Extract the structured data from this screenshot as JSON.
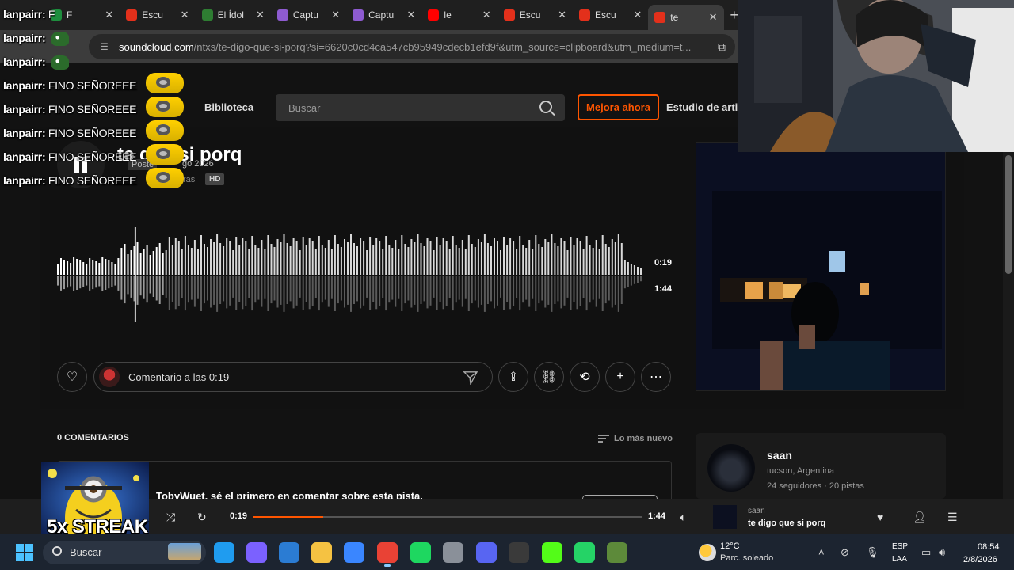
{
  "browser": {
    "tabs": [
      {
        "title": "F",
        "color": "#1e8e3e"
      },
      {
        "title": "Escu",
        "color": "#e3301b"
      },
      {
        "title": "El Ídol",
        "color": "#2e7d32"
      },
      {
        "title": "Captu",
        "color": "#8e5bd1"
      },
      {
        "title": "Captu",
        "color": "#8e5bd1"
      },
      {
        "title": "le",
        "color": "#ff0000"
      },
      {
        "title": "Escu",
        "color": "#e3301b"
      },
      {
        "title": "Escu",
        "color": "#e3301b"
      },
      {
        "title": "te",
        "color": "#e3301b",
        "active": true
      }
    ],
    "url_host": "soundcloud.com",
    "url_path": "/ntxs/te-digo-que-si-porq?si=6620c0cd4ca547cb95949cdecb1efd9f&utm_source=clipboard&utm_medium=t..."
  },
  "header": {
    "library": "Biblioteca",
    "search_placeholder": "Buscar",
    "upgrade": "Mejora ahora",
    "artist_studio": "Estudio de artis"
  },
  "track": {
    "title": "te digo que si porq",
    "title_visible": "te      que si porq",
    "posted": "Poste",
    "posted_date": "go 2026",
    "artist_tail": "ras",
    "hd": "HD",
    "current_time": "0:19",
    "total_time": "1:44",
    "progress_fraction": 0.18
  },
  "actions": {
    "comment_placeholder": "Comentario a las 0:19"
  },
  "comments": {
    "count_label": "0 COMENTARIOS",
    "sort_label": "Lo más nuevo",
    "empty_text": "TobyWuet, sé el primero en comentar sobre esta pista."
  },
  "artist": {
    "name": "saan",
    "location": "tucson, Argentina",
    "stats": "24 seguidores · 20 pistas"
  },
  "player": {
    "current": "0:19",
    "total": "1:44",
    "artist": "saan",
    "track": "te digo que si porq"
  },
  "chat": {
    "lines": [
      {
        "user": "lanpairr:",
        "msg": "F",
        "emote": "none"
      },
      {
        "user": "lanpairr:",
        "msg": "",
        "emote": "frog"
      },
      {
        "user": "lanpairr:",
        "msg": "",
        "emote": "frog"
      },
      {
        "user": "lanpairr:",
        "msg": "FINO SEÑOREEE",
        "emote": "minion"
      },
      {
        "user": "lanpairr:",
        "msg": "FINO SEÑOREEE",
        "emote": "minion"
      },
      {
        "user": "lanpairr:",
        "msg": "FINO SEÑOREEE",
        "emote": "minion"
      },
      {
        "user": "lanpairr:",
        "msg": "FINO SEÑOREEE",
        "emote": "minion"
      },
      {
        "user": "lanpairr:",
        "msg": "FINO SEÑOREEE",
        "emote": "minion"
      }
    ]
  },
  "overlay": {
    "streak": "5x STREAK"
  },
  "taskbar": {
    "search": "Buscar",
    "weather_temp": "12°C",
    "weather_desc": "Parc. soleado",
    "lang1": "ESP",
    "lang2": "LAA",
    "time": "08:54",
    "date": "2/8/2026",
    "apps": [
      {
        "name": "edge-icon",
        "color": "#1f9cf0"
      },
      {
        "name": "copilot-icon",
        "color": "#7b61ff"
      },
      {
        "name": "outlook-icon",
        "color": "#2b7cd3"
      },
      {
        "name": "file-explorer-icon",
        "color": "#f5c242"
      },
      {
        "name": "store-icon",
        "color": "#3a86ff"
      },
      {
        "name": "chrome-icon",
        "color": "#e94235"
      },
      {
        "name": "spotify-icon",
        "color": "#1ed760"
      },
      {
        "name": "settings-icon",
        "color": "#8a9099"
      },
      {
        "name": "discord-icon",
        "color": "#5865f2"
      },
      {
        "name": "obs-icon",
        "color": "#3a3a3a"
      },
      {
        "name": "kick-icon",
        "color": "#53fc18"
      },
      {
        "name": "whatsapp-icon",
        "color": "#25d366"
      },
      {
        "name": "minecraft-icon",
        "color": "#5d8a3a"
      }
    ]
  }
}
